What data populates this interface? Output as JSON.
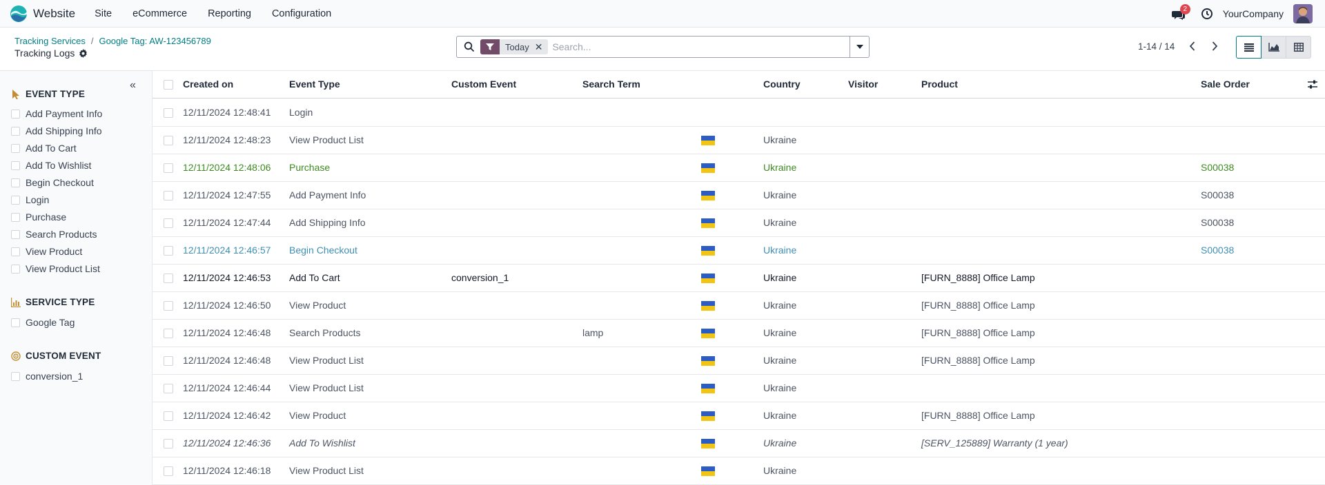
{
  "navbar": {
    "app_name": "Website",
    "menu": [
      "Site",
      "eCommerce",
      "Reporting",
      "Configuration"
    ],
    "message_count": "2",
    "company": "YourCompany"
  },
  "breadcrumb": {
    "items": [
      "Tracking Services",
      "Google Tag: AW-123456789"
    ],
    "current": "Tracking Logs"
  },
  "search": {
    "facet_label": "Today",
    "placeholder": "Search..."
  },
  "pager": {
    "text": "1-14 / 14"
  },
  "sidebar": {
    "sections": [
      {
        "title": "EVENT TYPE",
        "icon": "cursor-icon",
        "items": [
          "Add Payment Info",
          "Add Shipping Info",
          "Add To Cart",
          "Add To Wishlist",
          "Begin Checkout",
          "Login",
          "Purchase",
          "Search Products",
          "View Product",
          "View Product List"
        ]
      },
      {
        "title": "SERVICE TYPE",
        "icon": "bar-chart-icon",
        "items": [
          "Google Tag"
        ]
      },
      {
        "title": "CUSTOM EVENT",
        "icon": "target-icon",
        "items": [
          "conversion_1"
        ]
      }
    ]
  },
  "table": {
    "columns": [
      "Created on",
      "Event Type",
      "Custom Event",
      "Search Term",
      "Country",
      "Visitor",
      "Product",
      "Sale Order"
    ],
    "rows": [
      {
        "created": "12/11/2024 12:48:41",
        "event": "Login",
        "custom": "",
        "term": "",
        "flag": false,
        "country": "",
        "visitor": "",
        "product": "",
        "order": "",
        "style": "normal"
      },
      {
        "created": "12/11/2024 12:48:23",
        "event": "View Product List",
        "custom": "",
        "term": "",
        "flag": true,
        "country": "Ukraine",
        "visitor": "",
        "product": "",
        "order": "",
        "style": "normal"
      },
      {
        "created": "12/11/2024 12:48:06",
        "event": "Purchase",
        "custom": "",
        "term": "",
        "flag": true,
        "country": "Ukraine",
        "visitor": "",
        "product": "",
        "order": "S00038",
        "style": "success"
      },
      {
        "created": "12/11/2024 12:47:55",
        "event": "Add Payment Info",
        "custom": "",
        "term": "",
        "flag": true,
        "country": "Ukraine",
        "visitor": "",
        "product": "",
        "order": "S00038",
        "style": "normal"
      },
      {
        "created": "12/11/2024 12:47:44",
        "event": "Add Shipping Info",
        "custom": "",
        "term": "",
        "flag": true,
        "country": "Ukraine",
        "visitor": "",
        "product": "",
        "order": "S00038",
        "style": "normal"
      },
      {
        "created": "12/11/2024 12:46:57",
        "event": "Begin Checkout",
        "custom": "",
        "term": "",
        "flag": true,
        "country": "Ukraine",
        "visitor": "",
        "product": "",
        "order": "S00038",
        "style": "info"
      },
      {
        "created": "12/11/2024 12:46:53",
        "event": "Add To Cart",
        "custom": "conversion_1",
        "term": "",
        "flag": true,
        "country": "Ukraine",
        "visitor": "",
        "product": "[FURN_8888] Office Lamp",
        "order": "",
        "style": "bold"
      },
      {
        "created": "12/11/2024 12:46:50",
        "event": "View Product",
        "custom": "",
        "term": "",
        "flag": true,
        "country": "Ukraine",
        "visitor": "",
        "product": "[FURN_8888] Office Lamp",
        "order": "",
        "style": "normal"
      },
      {
        "created": "12/11/2024 12:46:48",
        "event": "Search Products",
        "custom": "",
        "term": "lamp",
        "flag": true,
        "country": "Ukraine",
        "visitor": "",
        "product": "[FURN_8888] Office Lamp",
        "order": "",
        "style": "normal"
      },
      {
        "created": "12/11/2024 12:46:48",
        "event": "View Product List",
        "custom": "",
        "term": "",
        "flag": true,
        "country": "Ukraine",
        "visitor": "",
        "product": "[FURN_8888] Office Lamp",
        "order": "",
        "style": "normal"
      },
      {
        "created": "12/11/2024 12:46:44",
        "event": "View Product List",
        "custom": "",
        "term": "",
        "flag": true,
        "country": "Ukraine",
        "visitor": "",
        "product": "",
        "order": "",
        "style": "normal"
      },
      {
        "created": "12/11/2024 12:46:42",
        "event": "View Product",
        "custom": "",
        "term": "",
        "flag": true,
        "country": "Ukraine",
        "visitor": "",
        "product": "[FURN_8888] Office Lamp",
        "order": "",
        "style": "normal"
      },
      {
        "created": "12/11/2024 12:46:36",
        "event": "Add To Wishlist",
        "custom": "",
        "term": "",
        "flag": true,
        "country": "Ukraine",
        "visitor": "",
        "product": "[SERV_125889] Warranty (1 year)",
        "order": "",
        "style": "italic"
      },
      {
        "created": "12/11/2024 12:46:18",
        "event": "View Product List",
        "custom": "",
        "term": "",
        "flag": true,
        "country": "Ukraine",
        "visitor": "",
        "product": "",
        "order": "",
        "style": "normal"
      }
    ]
  },
  "colors": {
    "brand": "#714b67",
    "link": "#017e84",
    "success": "#3d8b21",
    "info": "#3f8fb3",
    "badge": "#e0464e"
  }
}
